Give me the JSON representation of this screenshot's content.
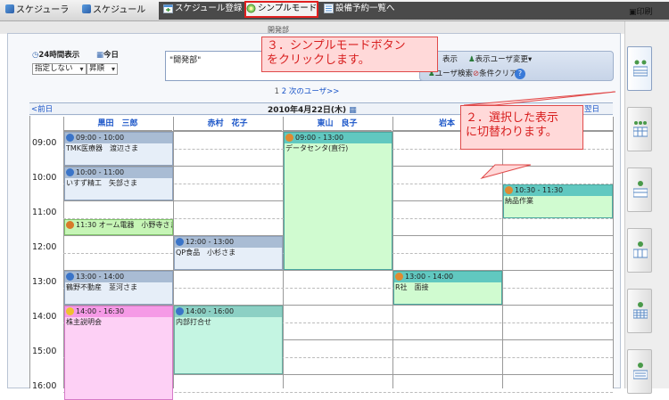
{
  "topbar": {
    "brand1": "スケジューラ",
    "brand2": "スケジュール",
    "menu": [
      {
        "label": "スケジュール登録",
        "icon": "calendar-add-icon"
      },
      {
        "label": "シンプルモード",
        "icon": "simple-mode-icon"
      },
      {
        "label": "設備予約一覧へ",
        "icon": "facility-list-icon"
      }
    ],
    "print_label": "印刷"
  },
  "tabstub": "開発部",
  "controls": {
    "view24": "24時間表示",
    "today": "今日",
    "sort_field": "指定しない",
    "sort_order": "昇順"
  },
  "dept_text": "\"開発部\"",
  "filter": {
    "display": "表示",
    "change_users": "表示ユーザ変更",
    "search": "ユーザ検索",
    "clear": "条件クリア"
  },
  "pager": {
    "current": "1",
    "link2": "2",
    "next_users": "次のユーザ>>"
  },
  "date": {
    "prev": "<前日",
    "label": "2010年4月22日(木)",
    "next": "翌日"
  },
  "columns": [
    "黒田　三郎",
    "赤村　花子",
    "東山　良子",
    "岩本",
    ""
  ],
  "times": [
    "09:00",
    "10:00",
    "11:00",
    "12:00",
    "13:00",
    "14:00",
    "15:00",
    "16:00"
  ],
  "events": [
    {
      "time": "09:00 - 10:00",
      "title": "TMK医療器　渡辺さま",
      "kind": "info"
    },
    {
      "time": "10:00 - 11:00",
      "title": "いすず精工　矢部さま",
      "kind": "info"
    },
    {
      "time": "11:30 オーム電器　小野寺さま",
      "title": "",
      "kind": "group"
    },
    {
      "time": "13:00 - 14:00",
      "title": "鶴野不動産　韮河さま",
      "kind": "info"
    },
    {
      "time": "14:00 - 16:30",
      "title": "株主説明会",
      "kind": "meeting"
    },
    {
      "time": "12:00 - 13:00",
      "title": "QP食品　小杉さま",
      "kind": "info"
    },
    {
      "time": "14:00 - 16:00",
      "title": "内部打合せ",
      "kind": "internal"
    },
    {
      "time": "09:00 - 13:00",
      "title": "データセンタ(直行)",
      "kind": "person"
    },
    {
      "time": "13:00 - 14:00",
      "title": "R社　面接",
      "kind": "person"
    },
    {
      "time": "10:30 - 11:30",
      "title": "納品作業",
      "kind": "person"
    }
  ],
  "callouts": {
    "c3": "３．シンプルモードボタン\nをクリックします。",
    "c2": "２．選択した表示\nに切替わります。"
  },
  "colors": {
    "info_head": "#a9bcd4",
    "info_body": "#e6eef8",
    "group": "#c6f5b6",
    "meeting_head": "#f59ae6",
    "meeting_body": "#fdd0f5",
    "internal_head": "#8cd0c4",
    "internal_body": "#c4f5e2",
    "person_head": "#61c8c0",
    "person_body": "#d0fbd0",
    "callout": "#e04a4a"
  }
}
